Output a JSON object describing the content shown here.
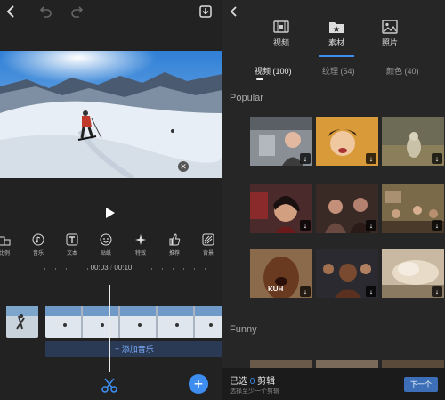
{
  "editor": {
    "tools": [
      {
        "label": "比例",
        "icon": "aspect-ratio-icon"
      },
      {
        "label": "音乐",
        "icon": "music-note-icon"
      },
      {
        "label": "文本",
        "icon": "text-icon"
      },
      {
        "label": "贴纸",
        "icon": "sticker-icon"
      },
      {
        "label": "特效",
        "icon": "sparkle-icon"
      },
      {
        "label": "推荐",
        "icon": "thumbs-up-icon"
      },
      {
        "label": "背景",
        "icon": "background-icon"
      }
    ],
    "current_time": "00:03",
    "total_time": "00:10",
    "time_separator": "/",
    "add_music_label": "添加音乐",
    "add_music_plus": "+",
    "fab_plus": "+",
    "close_glyph": "✕"
  },
  "picker": {
    "categories": [
      {
        "label": "视频",
        "icon": "film-icon"
      },
      {
        "label": "素材",
        "icon": "folder-star-icon"
      },
      {
        "label": "照片",
        "icon": "image-icon"
      }
    ],
    "subtabs": [
      "视频 (100)",
      "纹理 (54)",
      "颜色 (40)"
    ],
    "active_subtab": 0,
    "sections": [
      "Popular",
      "Funny"
    ],
    "tile_caption": "KUH",
    "download_glyph": "↓",
    "selection_prefix": "已选",
    "selection_count": "0",
    "selection_suffix": "剪辑",
    "selection_hint": "选择至少一个剪辑",
    "next_label": "下一个"
  },
  "colors": {
    "accent": "#3d8ef0",
    "background": "#222222"
  }
}
